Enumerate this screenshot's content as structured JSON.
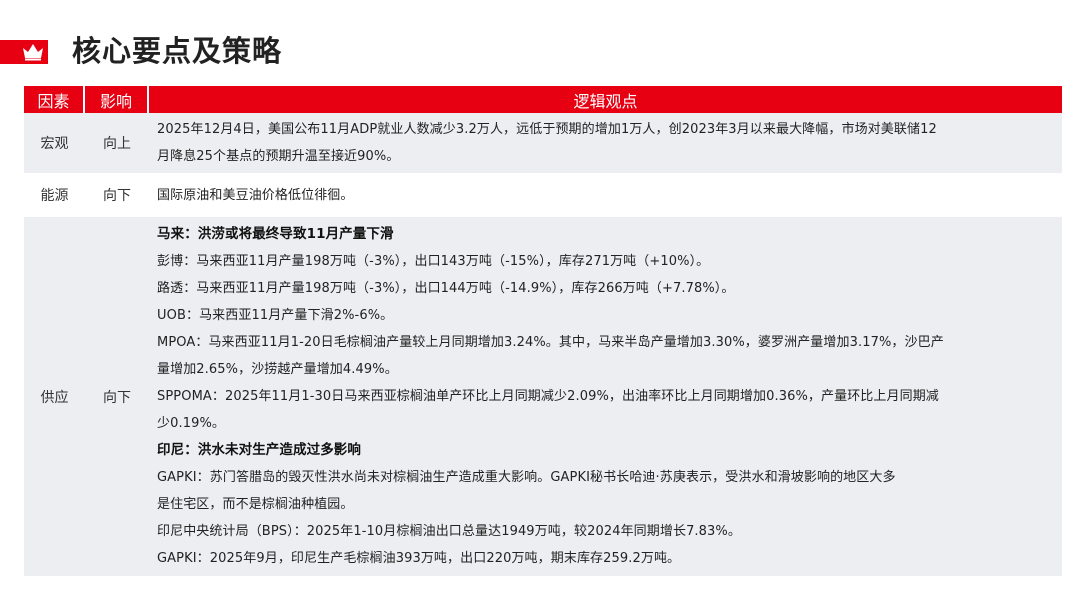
{
  "header": {
    "title": "核心要点及策略",
    "icon": "crown-icon",
    "accent_color": "#e60012"
  },
  "table": {
    "columns": [
      "因素",
      "影响",
      "逻辑观点"
    ],
    "rows": [
      {
        "factor": "宏观",
        "impact": "向上",
        "lines": [
          "2025年12月4日，美国公布11月ADP就业人数减少3.2万人，远低于预期的增加1万人，创2023年3月以来最大降幅，市场对美联储12",
          "月降息25个基点的预期升温至接近90%。"
        ]
      },
      {
        "factor": "能源",
        "impact": "向下",
        "lines": [
          "国际原油和美豆油价格低位徘徊。"
        ]
      },
      {
        "factor": "供应",
        "impact": "向下",
        "sections": [
          {
            "heading": "马来：洪涝或将最终导致11月产量下滑",
            "lines": [
              "彭博：马来西亚11月产量198万吨（-3%），出口143万吨（-15%），库存271万吨（+10%）。",
              "路透：马来西亚11月产量198万吨（-3%），出口144万吨（-14.9%），库存266万吨（+7.78%）。",
              "UOB：马来西亚11月产量下滑2%-6%。",
              "MPOA：马来西亚11月1-20日毛棕榈油产量较上月同期增加3.24%。其中，马来半岛产量增加3.30%，婆罗洲产量增加3.17%，沙巴产",
              "量增加2.65%，沙捞越产量增加4.49%。",
              "SPPOMA：2025年11月1-30日马来西亚棕榈油单产环比上月同期减少2.09%，出油率环比上月同期增加0.36%，产量环比上月同期减",
              "少0.19%。"
            ]
          },
          {
            "heading": "印尼：洪水未对生产造成过多影响",
            "lines": [
              "GAPKI：苏门答腊岛的毁灭性洪水尚未对棕榈油生产造成重大影响。GAPKI秘书长哈迪·苏庚表示，受洪水和滑坡影响的地区大多",
              "是住宅区，而不是棕榈油种植园。",
              "印尼中央统计局（BPS）：2025年1-10月棕榈油出口总量达1949万吨，较2024年同期增长7.83%。",
              "GAPKI：2025年9月，印尼生产毛棕榈油393万吨，出口220万吨，期末库存259.2万吨。"
            ]
          }
        ]
      }
    ]
  }
}
